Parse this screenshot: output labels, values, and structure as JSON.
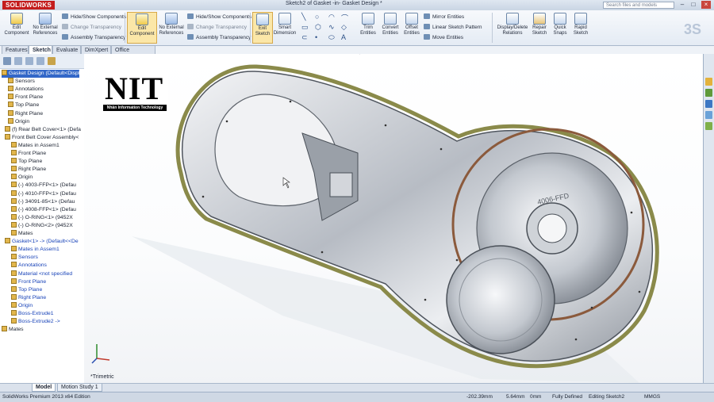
{
  "window": {
    "app_logo": "SOLIDWORKS",
    "doc_title": "Sketch2 of Gasket -in- Gasket Design *",
    "search_placeholder": "Search files and models"
  },
  "commands": {
    "edit_component": "Edit Component",
    "no_external_refs": "No External References",
    "hide_show": "Hide/Show Components",
    "change_transparency": "Change Transparency",
    "assembly_transparency": "Assembly Transparency",
    "exit_sketch": "Exit Sketch",
    "smart_dimension": "Smart Dimension",
    "trim_entities": "Trim Entities",
    "convert_entities": "Convert Entities",
    "offset_entities": "Offset Entities",
    "mirror_entities": "Mirror Entities",
    "linear_sketch_pattern": "Linear Sketch Pattern",
    "move_entities": "Move Entities",
    "display_delete_relations": "Display/Delete Relations",
    "repair_sketch": "Repair Sketch",
    "quick_snaps": "Quick Snaps",
    "rapid_sketch": "Rapid Sketch"
  },
  "tabs": [
    "Features",
    "Sketch",
    "Evaluate",
    "DimXpert",
    "Office Products"
  ],
  "active_tab": "Sketch",
  "tree": [
    {
      "label": "Gasket Design  (Default<Displ",
      "style": "sel"
    },
    {
      "label": "Sensors",
      "style": ""
    },
    {
      "label": "Annotations",
      "style": ""
    },
    {
      "label": "Front Plane",
      "style": ""
    },
    {
      "label": "Top Plane",
      "style": ""
    },
    {
      "label": "Right Plane",
      "style": ""
    },
    {
      "label": "Origin",
      "style": ""
    },
    {
      "label": "(f) Rear Belt Cover<1> (Defa",
      "style": ""
    },
    {
      "label": "Front Belt Cover Assembly<",
      "style": ""
    },
    {
      "label": "Mates in Assem1",
      "style": ""
    },
    {
      "label": "Front Plane",
      "style": ""
    },
    {
      "label": "Top Plane",
      "style": ""
    },
    {
      "label": "Right Plane",
      "style": ""
    },
    {
      "label": "Origin",
      "style": ""
    },
    {
      "label": "(-) 4003-FFP<1> (Defau",
      "style": ""
    },
    {
      "label": "(-) 4010-FFP<1> (Defau",
      "style": ""
    },
    {
      "label": "(-) 34091-85<1> (Defau",
      "style": ""
    },
    {
      "label": "(-) 4008-FFP<1> (Defau",
      "style": ""
    },
    {
      "label": "(-) O-RING<1> (9452X",
      "style": ""
    },
    {
      "label": "(-) O-RING<2> (9452X",
      "style": ""
    },
    {
      "label": "Mates",
      "style": ""
    },
    {
      "label": "Gasket<1> -> (Default<<De",
      "style": "blue"
    },
    {
      "label": "Mates in Assem1",
      "style": "blue"
    },
    {
      "label": "Sensors",
      "style": "blue"
    },
    {
      "label": "Annotations",
      "style": "blue"
    },
    {
      "label": "Material <not specified",
      "style": "blue"
    },
    {
      "label": "Front Plane",
      "style": "blue"
    },
    {
      "label": "Top Plane",
      "style": "blue"
    },
    {
      "label": "Right Plane",
      "style": "blue"
    },
    {
      "label": "Origin",
      "style": "blue"
    },
    {
      "label": "Boss-Extrude1",
      "style": "blue"
    },
    {
      "label": "Boss-Extrude2 ->",
      "style": "blue"
    },
    {
      "label": "Mates",
      "style": ""
    }
  ],
  "viewport": {
    "watermark_big": "NIT",
    "watermark_small": "Nhân Information Technology",
    "view_label": "*Trimetric",
    "part_stamp": "4006-FFD"
  },
  "bottom_tabs": [
    "Model",
    "Motion Study 1"
  ],
  "status": {
    "edition": "SolidWorks Premium 2013 x64 Edition",
    "x": "-202.39mm",
    "y": "5.64mm",
    "z": "0mm",
    "state": "Fully Defined",
    "editing": "Editing Sketch2",
    "units": "MMGS"
  }
}
